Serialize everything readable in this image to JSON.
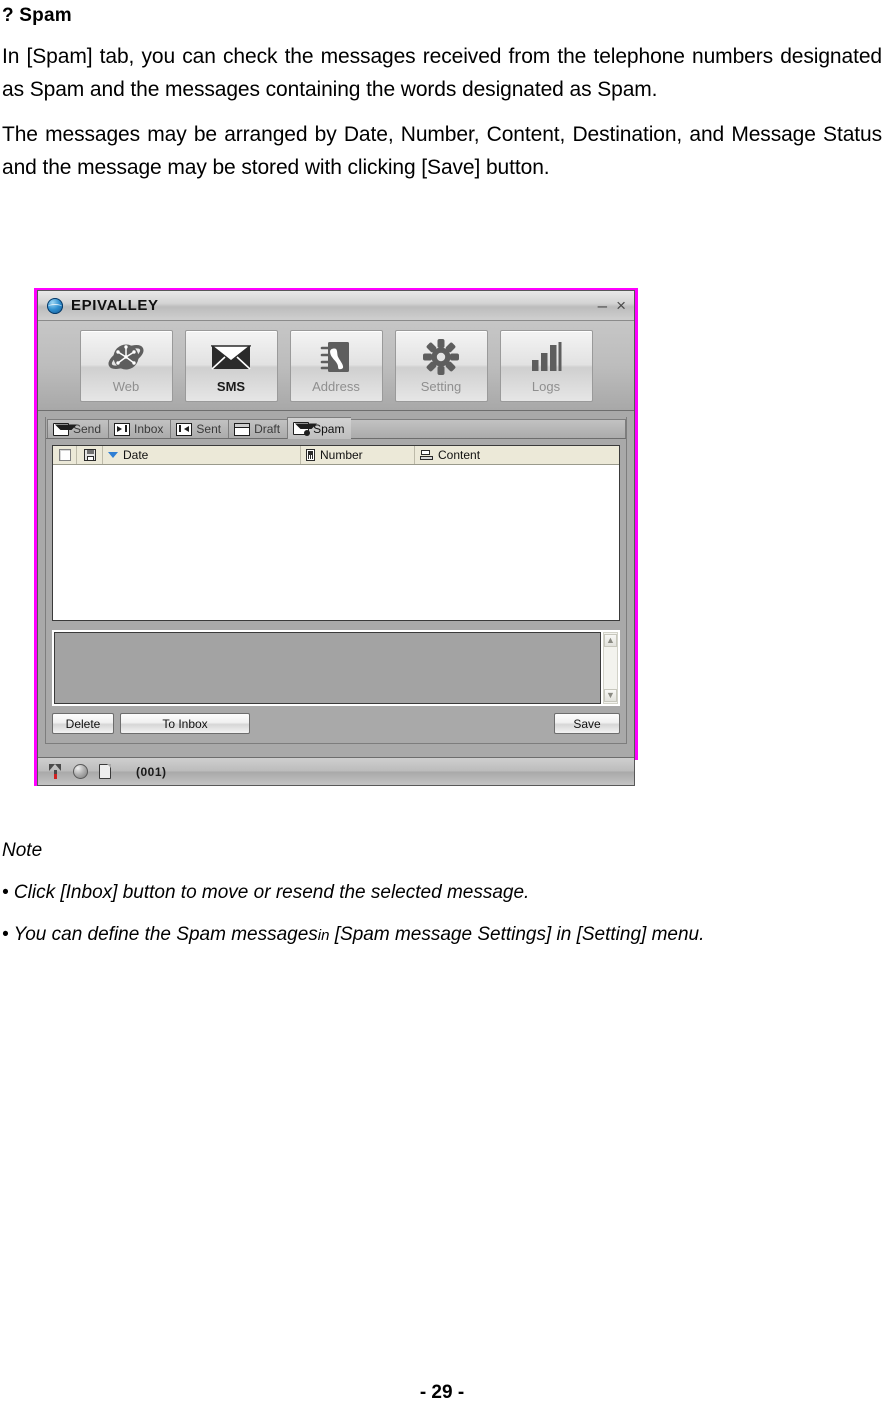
{
  "page": {
    "heading": "? Spam",
    "paragraphs": [
      "In [Spam] tab, you can check the messages received from the telephone numbers designated as Spam and the messages containing the words designated as Spam.",
      "The messages may be arranged by Date, Number, Content, Destination, and Message Status and the message may be stored with clicking [Save] button."
    ],
    "note": {
      "title": "Note",
      "items": [
        "• Click [Inbox] button to move or resend the selected message.",
        "• You can define the Spam messages"
      ],
      "item2_small": "in",
      "item2_tail": "[Spam message Settings] in [Setting] menu."
    },
    "footer": "- 29 -"
  },
  "app": {
    "titlebar": {
      "title": "EPIVALLEY",
      "minimize": "–",
      "close": "×"
    },
    "toolbar": [
      {
        "label": "Web",
        "icon": "globe-icon",
        "active": false
      },
      {
        "label": "SMS",
        "icon": "envelope-icon",
        "active": true
      },
      {
        "label": "Address",
        "icon": "address-book-icon",
        "active": false
      },
      {
        "label": "Setting",
        "icon": "gear-icon",
        "active": false
      },
      {
        "label": "Logs",
        "icon": "bar-chart-icon",
        "active": false
      }
    ],
    "tabs": [
      {
        "label": "Send",
        "icon": "envelope-icon",
        "active": false
      },
      {
        "label": "Inbox",
        "icon": "arrow-in-icon",
        "active": false
      },
      {
        "label": "Sent",
        "icon": "arrow-out-icon",
        "active": false
      },
      {
        "label": "Draft",
        "icon": "document-icon",
        "active": false
      },
      {
        "label": "Spam",
        "icon": "blocked-mail-icon",
        "active": true
      }
    ],
    "list": {
      "columns": [
        {
          "label": "",
          "icon": "checkbox-icon"
        },
        {
          "label": "",
          "icon": "floppy-save-icon"
        },
        {
          "label": "Date",
          "icon": "sort-descending-icon"
        },
        {
          "label": "Number",
          "icon": "mobile-phone-icon"
        },
        {
          "label": "Content",
          "icon": "message-content-icon"
        }
      ],
      "rows": []
    },
    "preview": {
      "value": ""
    },
    "buttons": {
      "delete": "Delete",
      "to_inbox": "To Inbox",
      "save": "Save"
    },
    "statusbar": {
      "icons": [
        "signal-strength-icon",
        "network-globe-icon",
        "sim-card-icon"
      ],
      "count": "(001)"
    },
    "colors": {
      "capture_border": "#ff00ff",
      "sort_arrow": "#2f7fd4",
      "header_bg": "#ece9d8",
      "signal_red": "#d02020"
    }
  }
}
